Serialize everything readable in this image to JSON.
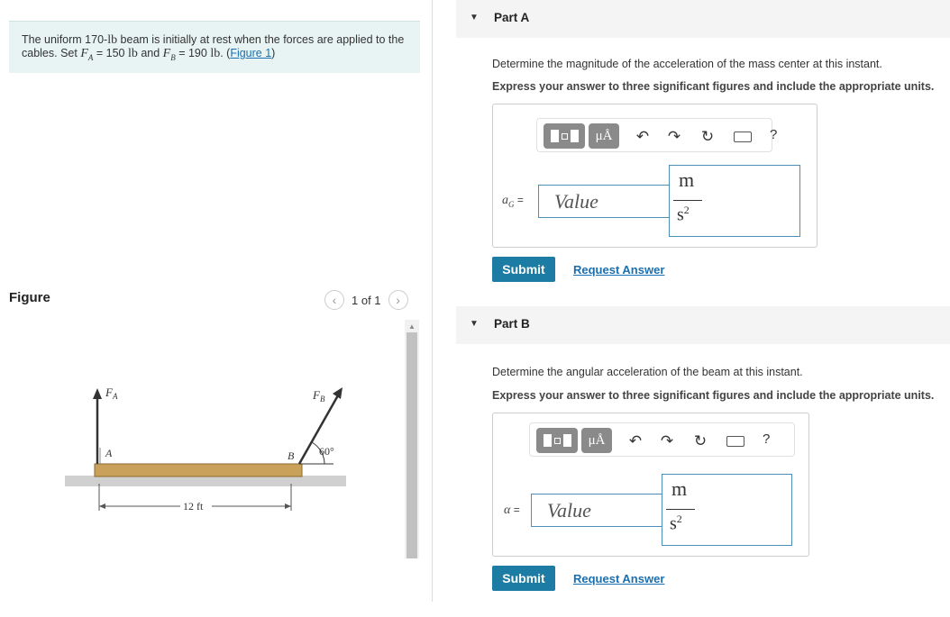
{
  "problem": {
    "text_a": "The uniform 170-",
    "unit_lb": "lb",
    "text_b": " beam is initially at rest when the forces are applied to the cables. Set ",
    "fa_sym": "F",
    "fa_sub": "A",
    "text_c": " = 150 ",
    "text_d": " and ",
    "fb_sym": "F",
    "fb_sub": "B",
    "text_e": " = 190 ",
    "text_f": ". (",
    "link": "Figure 1",
    "text_g": ")"
  },
  "figure": {
    "heading": "Figure",
    "pager": "1 of 1",
    "prev_icon": "chevron-left-icon",
    "next_icon": "chevron-right-icon",
    "label_fa": "F",
    "label_fa_sub": "A",
    "label_fb": "F",
    "label_fb_sub": "B",
    "label_a": "A",
    "label_b": "B",
    "angle": "60°",
    "length": "12 ft"
  },
  "part_a": {
    "title": "Part A",
    "question": "Determine the magnitude of the acceleration of the mass center at this instant.",
    "instruction": "Express your answer to three significant figures and include the appropriate units.",
    "var_sym": "a",
    "var_sub": "G",
    "var_eq": " =",
    "placeholder": "Value",
    "unit_num": "m",
    "unit_den": "s",
    "unit_exp": "2",
    "submit": "Submit",
    "request": "Request Answer"
  },
  "part_b": {
    "title": "Part B",
    "question": "Determine the angular acceleration of the beam at this instant.",
    "instruction": "Express your answer to three significant figures and include the appropriate units.",
    "var_sym": "α",
    "var_eq": " =",
    "placeholder": "Value",
    "unit_num": "m",
    "unit_den": "s",
    "unit_exp": "2",
    "submit": "Submit",
    "request": "Request Answer"
  },
  "toolbar": {
    "mu": "μÅ",
    "help": "?",
    "icons": [
      "templates-icon",
      "units-icon",
      "undo-icon",
      "redo-icon",
      "reset-icon",
      "keyboard-icon",
      "help-icon"
    ]
  }
}
